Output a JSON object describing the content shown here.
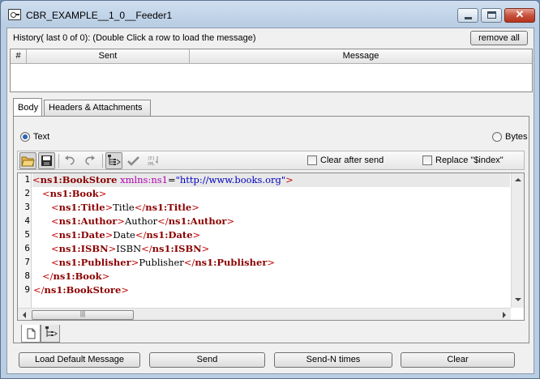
{
  "window": {
    "title": "CBR_EXAMPLE__1_0__Feeder1",
    "close_glyph": "✕"
  },
  "history": {
    "label": "History( last 0 of 0):    (Double Click a row to load the message)",
    "remove_all_label": "remove all",
    "columns": [
      "#",
      "Sent",
      "Message"
    ]
  },
  "tabs": [
    {
      "label": "Body",
      "selected": true
    },
    {
      "label": "Headers & Attachments",
      "selected": false
    }
  ],
  "format": {
    "text_label": "Text",
    "bytes_label": "Bytes",
    "selected": "Text"
  },
  "toolbar": {
    "clear_after_send_label": "Clear after send",
    "clear_after_send_checked": false,
    "replace_index_label": "Replace \"$index\"",
    "replace_index_checked": false,
    "icons": [
      "open-folder-icon",
      "save-icon",
      "undo-icon",
      "redo-icon",
      "xml-tree-icon",
      "validate-check-icon",
      "xml-format-icon"
    ]
  },
  "editor": {
    "line_numbers": [
      "1",
      "2",
      "3",
      "4",
      "5",
      "6",
      "7",
      "8",
      "9"
    ],
    "lines": [
      {
        "indent": "",
        "open": "<",
        "tag": "ns1:BookStore",
        "attr": " xmlns:ns1",
        "eq": "=",
        "val": "\"http://www.books.org\"",
        "close": ">"
      },
      {
        "indent": "   ",
        "open": "<",
        "tag": "ns1:Book",
        "close": ">"
      },
      {
        "indent": "      ",
        "open": "<",
        "tag": "ns1:Title",
        "close": ">",
        "text": "Title",
        "endopen": "</",
        "endtag": "ns1:Title",
        "endclose": ">"
      },
      {
        "indent": "      ",
        "open": "<",
        "tag": "ns1:Author",
        "close": ">",
        "text": "Author",
        "endopen": "</",
        "endtag": "ns1:Author",
        "endclose": ">"
      },
      {
        "indent": "      ",
        "open": "<",
        "tag": "ns1:Date",
        "close": ">",
        "text": "Date",
        "endopen": "</",
        "endtag": "ns1:Date",
        "endclose": ">"
      },
      {
        "indent": "      ",
        "open": "<",
        "tag": "ns1:ISBN",
        "close": ">",
        "text": "ISBN",
        "endopen": "</",
        "endtag": "ns1:ISBN",
        "endclose": ">"
      },
      {
        "indent": "      ",
        "open": "<",
        "tag": "ns1:Publisher",
        "close": ">",
        "text": "Publisher",
        "endopen": "</",
        "endtag": "ns1:Publisher",
        "endclose": ">"
      },
      {
        "indent": "   ",
        "open": "</",
        "tag": "ns1:Book",
        "close": ">"
      },
      {
        "indent": "",
        "open": "</",
        "tag": "ns1:BookStore",
        "close": ">"
      }
    ],
    "scroll_grip": "|||"
  },
  "bottom_tabs": [
    "text-view-icon",
    "tree-view-icon"
  ],
  "actions": {
    "load_default": "Load Default Message",
    "send": "Send",
    "send_n": "Send-N times",
    "clear": "Clear"
  }
}
